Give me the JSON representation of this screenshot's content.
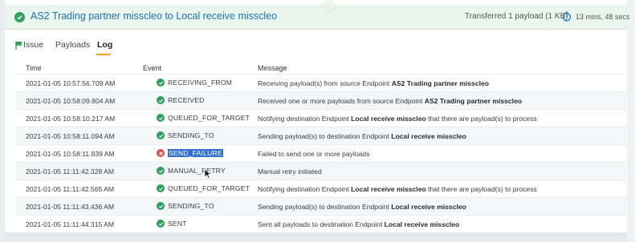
{
  "header": {
    "title": "AS2 Trading partner misscleo to Local receive misscleo",
    "transferred": "Transferred 1 payload (1 KB)",
    "duration": "13 mins, 48 secs",
    "status_icon": "check-circle-icon",
    "timer_icon": "stopwatch-icon"
  },
  "tabs": [
    {
      "label": "Issue",
      "icon": "flag-icon"
    },
    {
      "label": "Payloads"
    },
    {
      "label": "Log",
      "active": true
    }
  ],
  "table": {
    "headers": {
      "time": "Time",
      "event": "Event",
      "message": "Message"
    },
    "rows": [
      {
        "time": "2021-01-05 10:57:56.709 AM",
        "event": "RECEIVING_FROM",
        "status": "ok",
        "msg_pre": "Receiving payload(s) from source Endpoint ",
        "msg_bold": "AS2 Trading partner misscleo",
        "msg_post": ""
      },
      {
        "time": "2021-01-05 10:58:09.804 AM",
        "event": "RECEIVED",
        "status": "ok",
        "msg_pre": "Received one or more payloads from source Endpoint ",
        "msg_bold": "AS2 Trading partner misscleo",
        "msg_post": ""
      },
      {
        "time": "2021-01-05 10:58:10.217 AM",
        "event": "QUEUED_FOR_TARGET",
        "status": "ok",
        "msg_pre": "Notifying destination Endpoint ",
        "msg_bold": "Local receive misscleo",
        "msg_post": " that there are payload(s) to process"
      },
      {
        "time": "2021-01-05 10:58:11.094 AM",
        "event": "SENDING_TO",
        "status": "ok",
        "msg_pre": "Sending payload(s) to destination Endpoint ",
        "msg_bold": "Local receive misscleo",
        "msg_post": ""
      },
      {
        "time": "2021-01-05 10:58:11.839 AM",
        "event": "SEND_FAILURE",
        "status": "err",
        "selected": true,
        "msg_pre": "Failed to send one or more payloads",
        "msg_bold": "",
        "msg_post": ""
      },
      {
        "time": "2021-01-05 11:11:42.328 AM",
        "event": "MANUAL_RETRY",
        "status": "ok",
        "msg_pre": "Manual retry initiated",
        "msg_bold": "",
        "msg_post": ""
      },
      {
        "time": "2021-01-05 11:11:42.565 AM",
        "event": "QUEUED_FOR_TARGET",
        "status": "ok",
        "msg_pre": "Notifying destination Endpoint ",
        "msg_bold": "Local receive misscleo",
        "msg_post": " that there are payload(s) to process"
      },
      {
        "time": "2021-01-05 11:11:43.436 AM",
        "event": "SENDING_TO",
        "status": "ok",
        "msg_pre": "Sending payload(s) to destination Endpoint ",
        "msg_bold": "Local receive misscleo",
        "msg_post": ""
      },
      {
        "time": "2021-01-05 11:11:44.315 AM",
        "event": "SENT",
        "status": "ok",
        "msg_pre": "Sent all payloads to destination Endpoint ",
        "msg_bold": "Local receive misscleo",
        "msg_post": ""
      }
    ]
  },
  "colors": {
    "success": "#2e9e5b",
    "failure": "#d9534f",
    "title_link": "#1a73b8",
    "tab_active_underline": "#f0a020",
    "selection": "#2f6fd0"
  }
}
